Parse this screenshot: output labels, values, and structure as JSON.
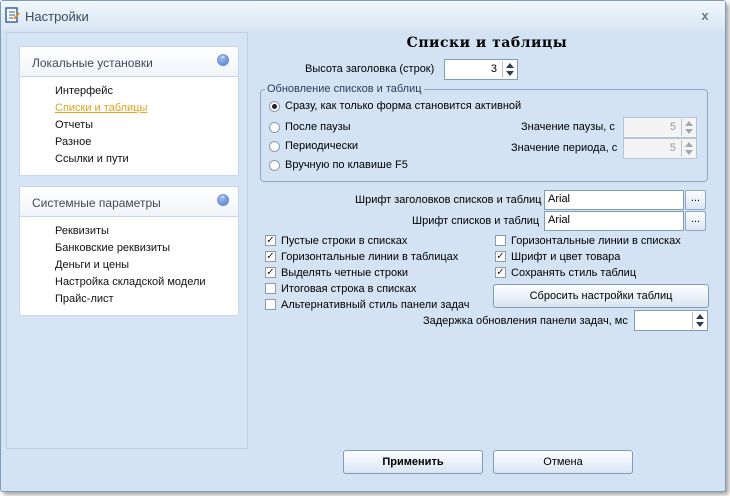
{
  "window": {
    "title": "Настройки"
  },
  "sidebar": {
    "local_group": {
      "title": "Локальные установки",
      "items": [
        "Интерфейс",
        "Списки и таблицы",
        "Отчеты",
        "Разное",
        "Ссылки и пути"
      ]
    },
    "system_group": {
      "title": "Системные параметры",
      "items": [
        "Реквизиты",
        "Банковские реквизиты",
        "Деньги и цены",
        "Настройка складской модели",
        "Прайс-лист"
      ]
    },
    "active_item": "Списки и таблицы"
  },
  "main": {
    "title": "Списки и таблицы",
    "header_height": {
      "label": "Высота заголовка (строк)",
      "value": "3"
    },
    "refresh_group": {
      "legend": "Обновление списков и таблиц",
      "options": [
        "Сразу, как только форма становится активной",
        "После паузы",
        "Периодически",
        "Вручную по клавише F5"
      ],
      "selected": "Сразу, как только форма становится активной",
      "pause": {
        "label": "Значение паузы, с",
        "value": "5"
      },
      "period": {
        "label": "Значение периода, с",
        "value": "5"
      }
    },
    "header_font": {
      "label": "Шрифт заголовков списков и таблиц",
      "value": "Arial",
      "button": "..."
    },
    "list_font": {
      "label": "Шрифт списков и таблиц",
      "value": "Arial",
      "button": "..."
    },
    "checkboxes_left": [
      {
        "label": "Пустые строки в списках",
        "checked": true
      },
      {
        "label": "Горизонтальные линии в таблицах",
        "checked": true
      },
      {
        "label": "Выделять четные строки",
        "checked": true
      },
      {
        "label": "Итоговая строка в списках",
        "checked": false
      },
      {
        "label": "Альтернативный стиль панели задач",
        "checked": false
      }
    ],
    "checkboxes_right": [
      {
        "label": "Горизонтальные линии в списках",
        "checked": false
      },
      {
        "label": "Шрифт и цвет товара",
        "checked": true
      },
      {
        "label": "Сохранять стиль таблиц",
        "checked": true
      }
    ],
    "reset_button": "Сбросить настройки таблиц",
    "taskbar_delay": {
      "label": "Задержка обновления панели задач, мс",
      "value": ""
    }
  },
  "footer": {
    "apply": "Применить",
    "cancel": "Отмена"
  },
  "colors": {
    "window_bg": "#d3e3f4",
    "active_link": "#e2a21b",
    "border": "#7f9db9"
  }
}
